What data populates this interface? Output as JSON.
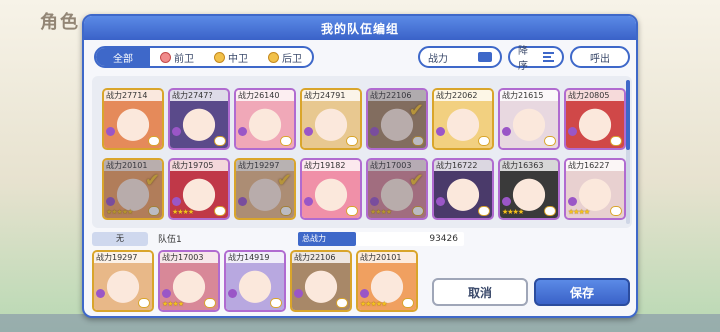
{
  "background": {
    "title": "角色"
  },
  "dialog": {
    "title": "我的队伍编组"
  },
  "toolbar": {
    "tabs": [
      {
        "label": "全部",
        "active": true
      },
      {
        "label": "前卫",
        "active": false
      },
      {
        "label": "中卫",
        "active": false
      },
      {
        "label": "后卫",
        "active": false
      }
    ],
    "power_label": "战力",
    "sort_label": "降序",
    "call_label": "呼出"
  },
  "roster": [
    {
      "power": "战力27714",
      "frame": "gold",
      "stars": "",
      "selected": false,
      "color": "#e58a5a"
    },
    {
      "power": "战力2747?",
      "frame": "purple",
      "stars": "",
      "selected": false,
      "color": "#5a4a8a"
    },
    {
      "power": "战力26140",
      "frame": "purple",
      "stars": "",
      "selected": false,
      "color": "#f0a8b8"
    },
    {
      "power": "战力24791",
      "frame": "gold",
      "stars": "",
      "selected": false,
      "color": "#e8c890"
    },
    {
      "power": "战力22106",
      "frame": "purple",
      "stars": "",
      "selected": true,
      "color": "#a88868"
    },
    {
      "power": "战力22062",
      "frame": "gold",
      "stars": "",
      "selected": false,
      "color": "#f2d080"
    },
    {
      "power": "战力21615",
      "frame": "purple",
      "stars": "",
      "selected": false,
      "color": "#e8d8e0"
    },
    {
      "power": "战力20805",
      "frame": "purple",
      "stars": "",
      "selected": false,
      "color": "#d04848"
    },
    {
      "power": "战力20101",
      "frame": "gold",
      "stars": "★★★★★",
      "selected": true,
      "color": "#f0a060"
    },
    {
      "power": "战力19705",
      "frame": "purple",
      "stars": "★★★★",
      "selected": false,
      "color": "#c03848"
    },
    {
      "power": "战力19297",
      "frame": "gold",
      "stars": "",
      "selected": true,
      "color": "#e8b888"
    },
    {
      "power": "战力19182",
      "frame": "purple",
      "stars": "",
      "selected": false,
      "color": "#f090a8"
    },
    {
      "power": "战力17003",
      "frame": "purple",
      "stars": "★★★★",
      "selected": true,
      "color": "#d88898"
    },
    {
      "power": "战力16722",
      "frame": "purple",
      "stars": "",
      "selected": false,
      "color": "#4a3a6a"
    },
    {
      "power": "战力16363",
      "frame": "purple",
      "stars": "★★★★",
      "selected": false,
      "color": "#3a3a3a"
    },
    {
      "power": "战力16227",
      "frame": "purple",
      "stars": "★★★★",
      "selected": false,
      "color": "#e8d0d0"
    }
  ],
  "team": {
    "label": "无",
    "name": "队伍1",
    "total_label": "总战力",
    "total_power": "93426",
    "members": [
      {
        "power": "战力19297",
        "frame": "gold",
        "stars": "",
        "color": "#e8b888"
      },
      {
        "power": "战力17003",
        "frame": "purple",
        "stars": "★★★★",
        "color": "#d88898"
      },
      {
        "power": "战力14919",
        "frame": "purple",
        "stars": "",
        "color": "#b8a8e0"
      },
      {
        "power": "战力22106",
        "frame": "gold",
        "stars": "",
        "color": "#a88868"
      },
      {
        "power": "战力20101",
        "frame": "gold",
        "stars": "★★★★★",
        "color": "#f0a060"
      }
    ]
  },
  "buttons": {
    "cancel": "取消",
    "save": "保存"
  }
}
